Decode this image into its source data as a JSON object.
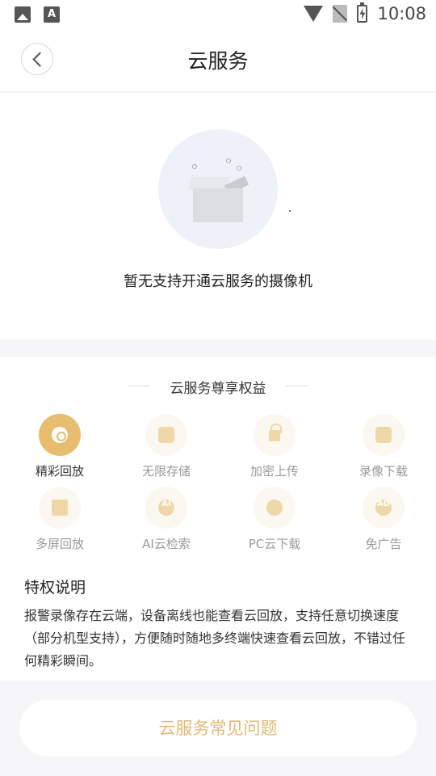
{
  "status": {
    "time": "10:08"
  },
  "header": {
    "title": "云服务"
  },
  "empty_state": {
    "message": "暂无支持开通云服务的摄像机"
  },
  "benefits": {
    "title": "云服务尊享权益",
    "items": [
      {
        "label": "精彩回放",
        "icon": "replay-icon",
        "active": true
      },
      {
        "label": "无限存储",
        "icon": "storage-icon"
      },
      {
        "label": "加密上传",
        "icon": "lock-icon"
      },
      {
        "label": "录像下载",
        "icon": "video-icon"
      },
      {
        "label": "多屏回放",
        "icon": "multi-screen-icon"
      },
      {
        "label": "AI云检索",
        "icon": "ai-cloud-icon",
        "badge": "AI"
      },
      {
        "label": "PC云下载",
        "icon": "cloud-download-icon"
      },
      {
        "label": "免广告",
        "icon": "no-ads-icon",
        "badge": "AD"
      }
    ]
  },
  "privilege": {
    "title": "特权说明",
    "text": "报警录像存在云端，设备离线也能查看云回放，支持任意切换速度（部分机型支持），方便随时随地多终端快速查看云回放，不错过任何精彩瞬间。"
  },
  "faq": {
    "label": "云服务常见问题"
  },
  "colors": {
    "accent": "#e8bd6e",
    "accent_text": "#e4b96f"
  }
}
